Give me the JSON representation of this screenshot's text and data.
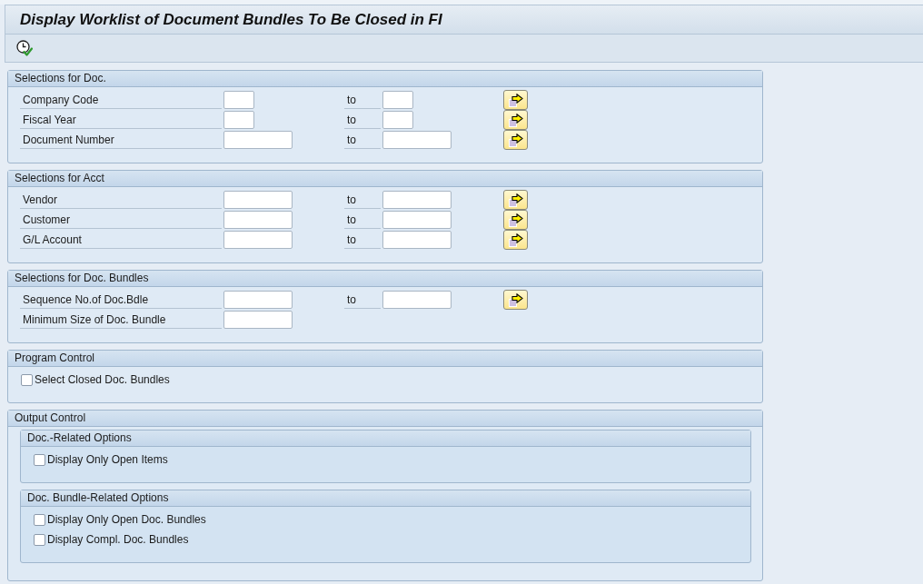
{
  "window": {
    "title": "Display Worklist of Document Bundles To Be Closed in FI"
  },
  "groups": [
    {
      "title": "Selections for Doc.",
      "rows": [
        {
          "kind": "shortrange",
          "label": "Company Code",
          "to": "to"
        },
        {
          "kind": "shortrange",
          "label": "Fiscal Year",
          "to": "to"
        },
        {
          "kind": "range",
          "label": "Document Number",
          "to": "to"
        }
      ]
    },
    {
      "title": "Selections for Acct",
      "rows": [
        {
          "kind": "range",
          "label": "Vendor",
          "to": "to"
        },
        {
          "kind": "range",
          "label": "Customer",
          "to": "to"
        },
        {
          "kind": "range",
          "label": "G/L Account",
          "to": "to"
        }
      ]
    },
    {
      "title": "Selections for Doc. Bundles",
      "rows": [
        {
          "kind": "range",
          "label": "Sequence No.of Doc.Bdle",
          "to": "to"
        },
        {
          "kind": "single",
          "label": "Minimum Size of Doc. Bundle"
        }
      ]
    },
    {
      "title": "Program Control",
      "rows": [
        {
          "kind": "checkbox",
          "label": "Select Closed Doc. Bundles",
          "checked": false
        }
      ]
    },
    {
      "title": "Output Control",
      "subgroups": [
        {
          "title": "Doc.-Related Options",
          "rows": [
            {
              "kind": "checkbox",
              "label": "Display Only Open Items",
              "checked": false
            }
          ]
        },
        {
          "title": "Doc. Bundle-Related Options",
          "rows": [
            {
              "kind": "checkbox",
              "label": "Display Only Open Doc. Bundles",
              "checked": false
            },
            {
              "kind": "checkbox",
              "label": "Display Compl. Doc. Bundles",
              "checked": false
            }
          ]
        }
      ]
    }
  ]
}
